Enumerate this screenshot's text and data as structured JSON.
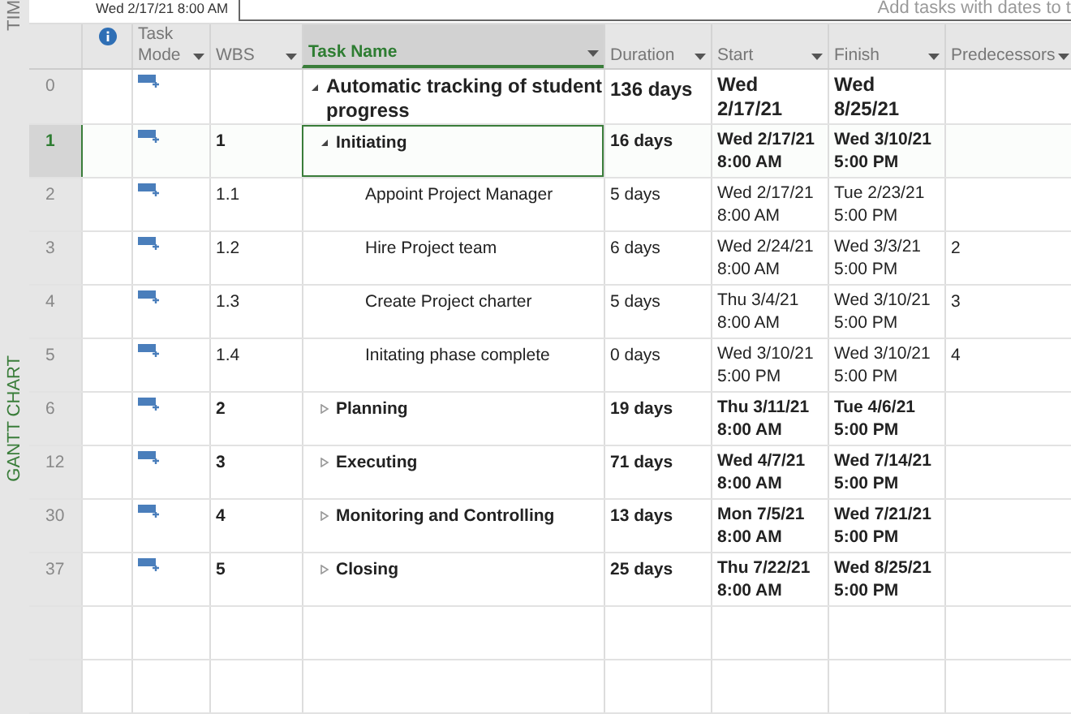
{
  "side_tabs": [
    "TIM",
    "GANTT CHART"
  ],
  "timeline": {
    "start_label": "Wed 2/17/21 8:00 AM",
    "placeholder": "Add tasks with dates to t"
  },
  "columns": [
    {
      "kind": "info"
    },
    {
      "kind": "text",
      "label": "Task Mode",
      "selected": false
    },
    {
      "kind": "text",
      "label": "WBS",
      "selected": false
    },
    {
      "kind": "text",
      "label": "Task Name",
      "selected": true
    },
    {
      "kind": "text",
      "label": "Duration",
      "selected": false
    },
    {
      "kind": "text",
      "label": "Start",
      "selected": false
    },
    {
      "kind": "text",
      "label": "Finish",
      "selected": false
    },
    {
      "kind": "text",
      "label": "Predecessors",
      "selected": false
    }
  ],
  "tasks": [
    {
      "id": "0",
      "name": "Automatic tracking of student progress",
      "duration": "136 days",
      "start": [
        "Wed",
        "2/17/21"
      ],
      "finish": [
        "Wed",
        "8/25/21"
      ],
      "summary": true,
      "expanded": true,
      "selected": false,
      "children": [
        {
          "id": "1",
          "wbs": "1",
          "name": "Initiating",
          "duration": "16 days",
          "start": [
            "Wed 2/17/21",
            "8:00 AM"
          ],
          "finish": [
            "Wed 3/10/21",
            "5:00 PM"
          ],
          "summary": true,
          "expanded": true,
          "selected": true,
          "children": [
            {
              "id": "2",
              "wbs": "1.1",
              "name": "Appoint Project Manager",
              "duration": "5 days",
              "start": [
                "Wed 2/17/21",
                "8:00 AM"
              ],
              "finish": [
                "Tue 2/23/21",
                "5:00 PM"
              ],
              "summary": false,
              "selected": false
            },
            {
              "id": "3",
              "wbs": "1.2",
              "name": "Hire Project team",
              "duration": "6 days",
              "start": [
                "Wed 2/24/21",
                "8:00 AM"
              ],
              "finish": [
                "Wed 3/3/21",
                "5:00 PM"
              ],
              "predecessors": "2",
              "summary": false,
              "selected": false
            },
            {
              "id": "4",
              "wbs": "1.3",
              "name": "Create Project charter",
              "duration": "5 days",
              "start": [
                "Thu 3/4/21",
                "8:00 AM"
              ],
              "finish": [
                "Wed 3/10/21",
                "5:00 PM"
              ],
              "predecessors": "3",
              "summary": false,
              "selected": false
            },
            {
              "id": "5",
              "wbs": "1.4",
              "name": "Initating phase complete",
              "duration": "0 days",
              "start": [
                "Wed 3/10/21",
                "5:00 PM"
              ],
              "finish": [
                "Wed 3/10/21",
                "5:00 PM"
              ],
              "predecessors": "4",
              "summary": false,
              "selected": false
            }
          ]
        },
        {
          "id": "6",
          "wbs": "2",
          "name": "Planning",
          "duration": "19 days",
          "start": [
            "Thu 3/11/21",
            "8:00 AM"
          ],
          "finish": [
            "Tue 4/6/21",
            "5:00 PM"
          ],
          "summary": true,
          "expanded": false,
          "selected": false
        },
        {
          "id": "12",
          "wbs": "3",
          "name": "Executing",
          "duration": "71 days",
          "start": [
            "Wed 4/7/21",
            "8:00 AM"
          ],
          "finish": [
            "Wed 7/14/21",
            "5:00 PM"
          ],
          "summary": true,
          "expanded": false,
          "selected": false
        },
        {
          "id": "30",
          "wbs": "4",
          "name": "Monitoring and Controlling",
          "duration": "13 days",
          "start": [
            "Mon 7/5/21",
            "8:00 AM"
          ],
          "finish": [
            "Wed 7/21/21",
            "5:00 PM"
          ],
          "summary": true,
          "expanded": false,
          "selected": false
        },
        {
          "id": "37",
          "wbs": "5",
          "name": "Closing",
          "duration": "25 days",
          "start": [
            "Thu 7/22/21",
            "8:00 AM"
          ],
          "finish": [
            "Wed 8/25/21",
            "5:00 PM"
          ],
          "summary": true,
          "expanded": false,
          "selected": false
        }
      ]
    }
  ]
}
